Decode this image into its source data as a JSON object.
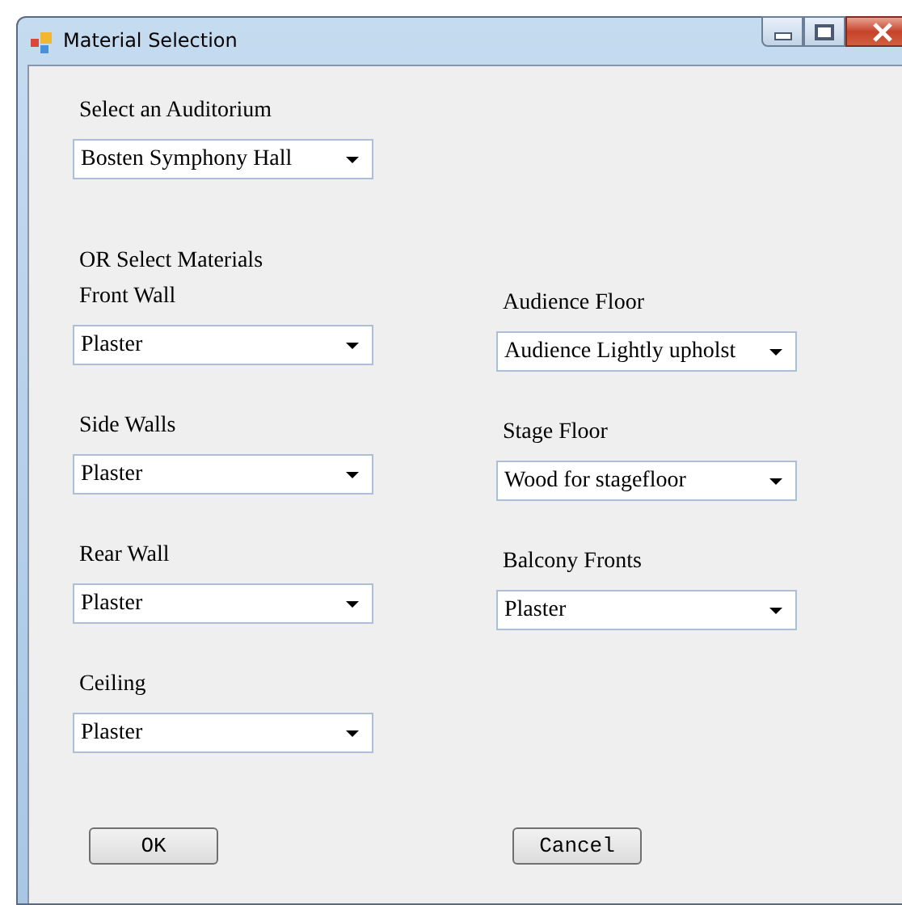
{
  "window": {
    "title": "Material Selection"
  },
  "auditorium": {
    "label": "Select an Auditorium",
    "value": "Bosten Symphony Hall"
  },
  "materials_heading": "OR Select Materials",
  "left_fields": [
    {
      "label": "Front Wall",
      "value": "Plaster"
    },
    {
      "label": "Side Walls",
      "value": "Plaster"
    },
    {
      "label": "Rear Wall",
      "value": "Plaster"
    },
    {
      "label": "Ceiling",
      "value": "Plaster"
    }
  ],
  "right_fields": [
    {
      "label": "Audience Floor",
      "value": "Audience Lightly upholst"
    },
    {
      "label": "Stage Floor",
      "value": "Wood for stagefloor"
    },
    {
      "label": "Balcony Fronts",
      "value": "Plaster"
    }
  ],
  "buttons": [
    "OK",
    "Cancel"
  ]
}
